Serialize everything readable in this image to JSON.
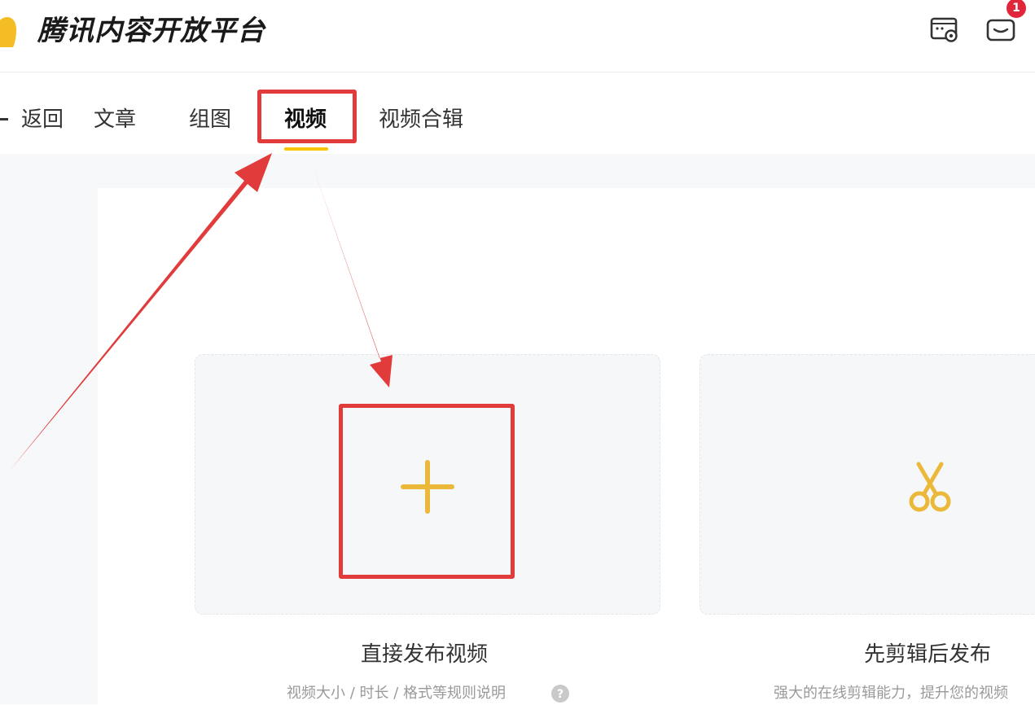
{
  "header": {
    "title": "腾讯内容开放平台",
    "logo_icon": "penguin-logo-icon",
    "settings_icon": "screen-settings-icon",
    "message_icon": "message-inbox-icon",
    "message_badge": "1",
    "badge_color": "#e0263a"
  },
  "tabs": {
    "back_label": "返回",
    "items": [
      {
        "label": "文章"
      },
      {
        "label": "组图"
      },
      {
        "label": "视频",
        "active": true
      },
      {
        "label": "视频合辑"
      }
    ],
    "active_underline_color": "#f7c600"
  },
  "main": {
    "cards": [
      {
        "icon": "plus-icon",
        "label": "直接发布视频",
        "description": "视频大小 / 时长 / 格式等规则说明",
        "help_icon": "question-circle-icon"
      },
      {
        "icon": "scissors-icon",
        "label": "先剪辑后发布",
        "description": "强大的在线剪辑能力，提升您的视频"
      }
    ],
    "accent_color": "#ebb83a"
  },
  "annotations": {
    "highlight_color": "#e23b3b"
  }
}
